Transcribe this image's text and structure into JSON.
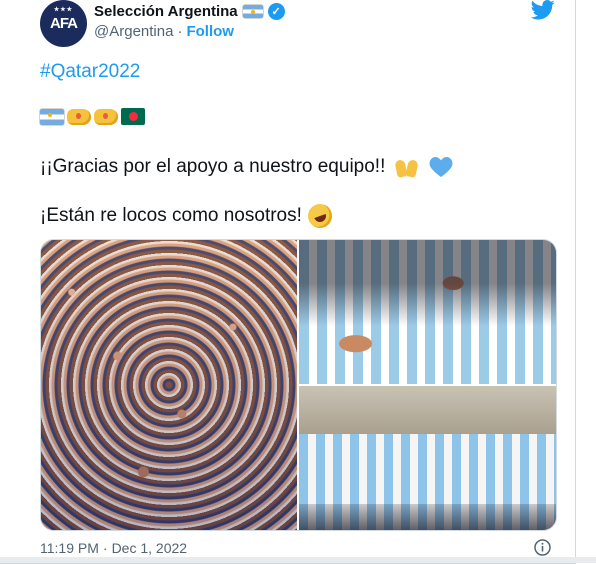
{
  "tweet": {
    "author": {
      "display_name": "Selección Argentina",
      "handle": "@Argentina",
      "separator": "·",
      "follow_label": "Follow",
      "avatar_text": "AFA"
    },
    "hashtag": "#Qatar2022",
    "emoji_line": [
      "argentina-flag",
      "fist-bump-left",
      "fist-bump-right",
      "bangladesh-flag"
    ],
    "line1": "¡¡Gracias por el apoyo a nuestro equipo!!",
    "line2": "¡Están re locos como nosotros!",
    "timestamp": "11:19 PM",
    "date_separator": "·",
    "date": "Dec 1, 2022"
  },
  "colors": {
    "link": "#1d9bf0",
    "secondary_text": "#536471",
    "heart": "#5dadec"
  }
}
